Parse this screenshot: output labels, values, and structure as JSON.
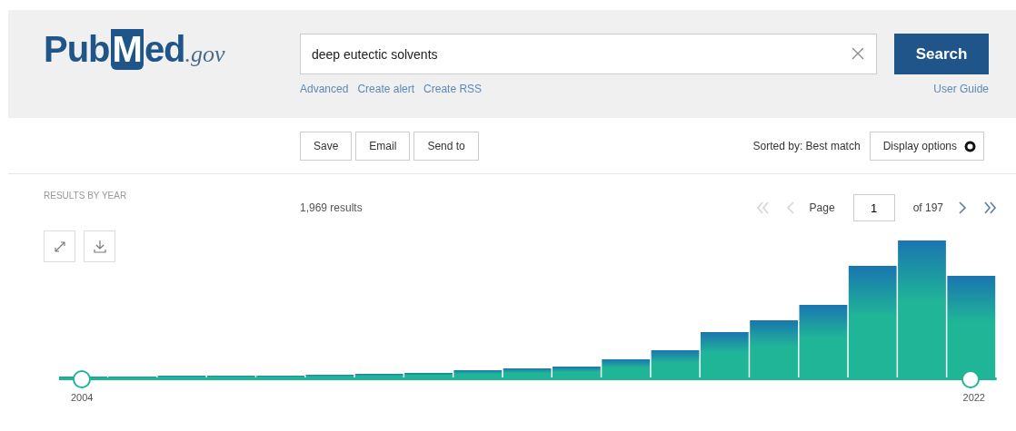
{
  "header": {
    "logo": [
      {
        "text": "Pub",
        "kind": "plain"
      },
      {
        "text": "M",
        "kind": "flag"
      },
      {
        "text": "ed",
        "kind": "plain"
      },
      {
        "text": ".gov",
        "kind": "domain"
      }
    ],
    "search": {
      "value": "deep eutectic solvents",
      "button": "Search"
    },
    "links": [
      "Advanced",
      "Create alert",
      "Create RSS"
    ],
    "user_guide": "User Guide"
  },
  "toolbar": {
    "actions": [
      "Save",
      "Email",
      "Send to"
    ],
    "sort_label": "Sorted by: Best match",
    "display_options": "Display options"
  },
  "results": {
    "heading": "RESULTS BY YEAR",
    "count": "1,969 results",
    "pager": {
      "buttons": [
        {
          "kind": "first",
          "disabled": true
        },
        {
          "kind": "prev",
          "disabled": true
        },
        {
          "kind": "next",
          "disabled": false
        },
        {
          "kind": "last",
          "disabled": false
        }
      ],
      "label": "Page",
      "value": "1",
      "of": "of 197"
    },
    "timeline": {
      "start": "2004",
      "end": "2022"
    }
  }
}
